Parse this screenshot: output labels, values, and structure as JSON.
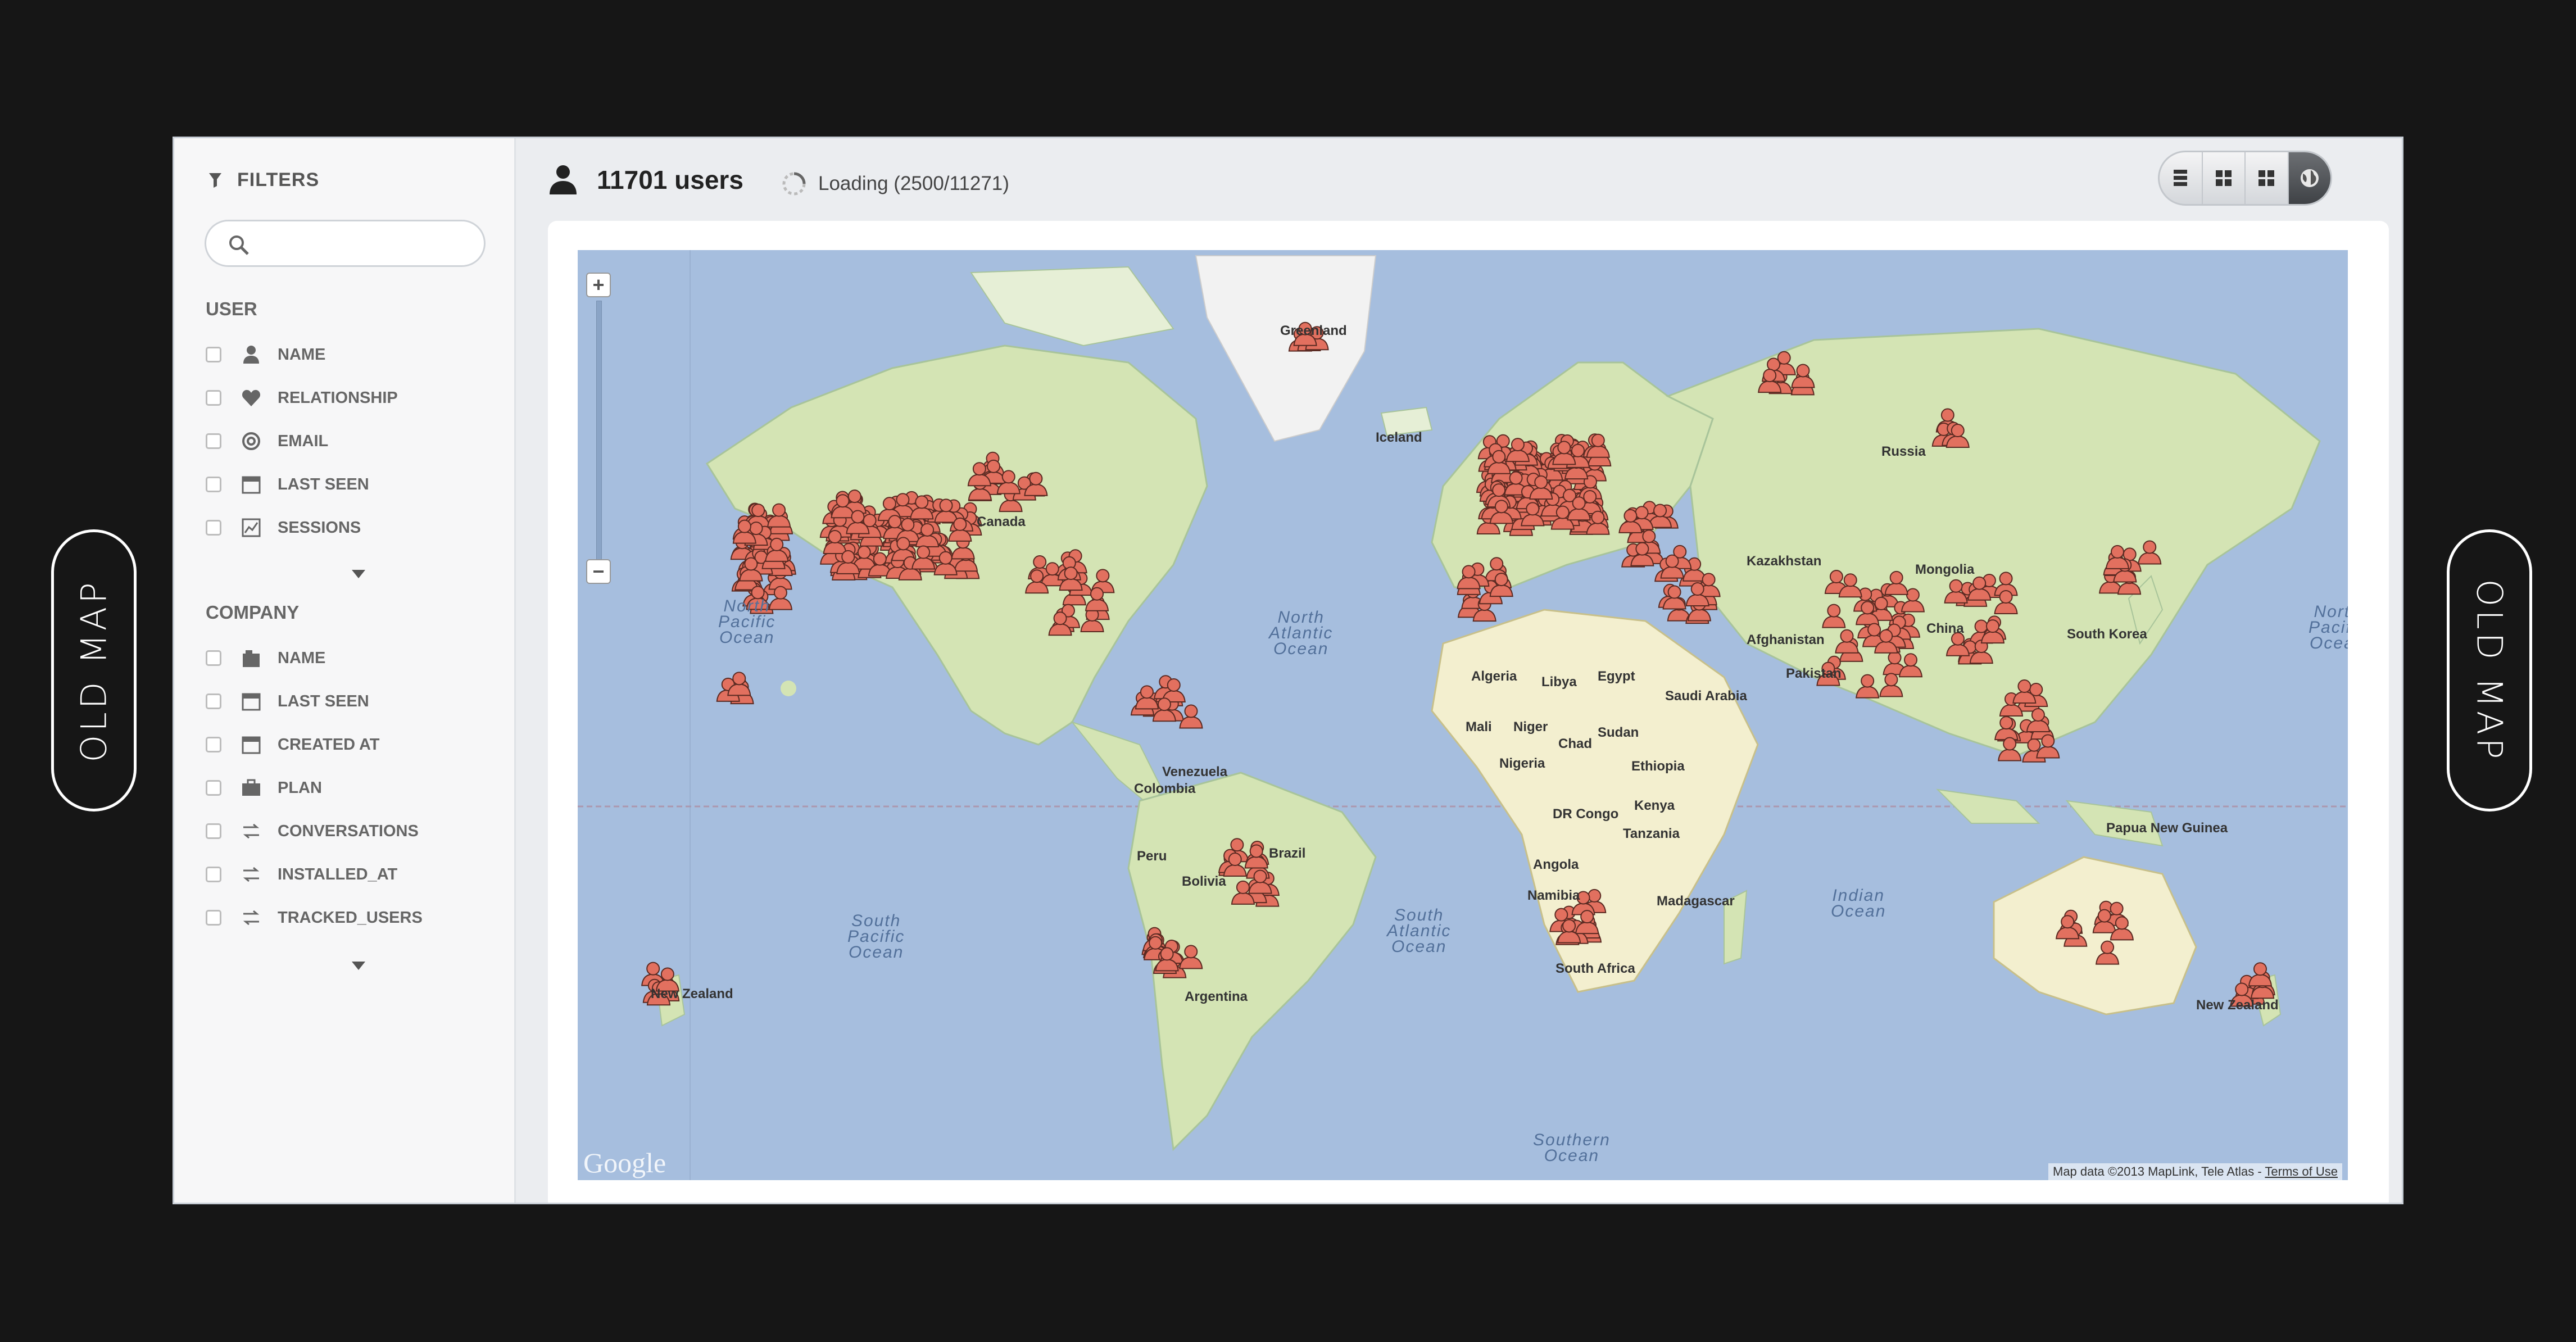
{
  "side_labels": {
    "left": "OLD MAP",
    "right": "OLD MAP"
  },
  "sidebar": {
    "filters_title": "FILTERS",
    "search_placeholder": "",
    "user_group": {
      "title": "USER",
      "items": [
        {
          "label": "NAME",
          "icon": "user-icon"
        },
        {
          "label": "RELATIONSHIP",
          "icon": "heart-icon"
        },
        {
          "label": "EMAIL",
          "icon": "at-icon"
        },
        {
          "label": "LAST SEEN",
          "icon": "calendar-icon"
        },
        {
          "label": "SESSIONS",
          "icon": "chart-icon"
        }
      ]
    },
    "company_group": {
      "title": "COMPANY",
      "items": [
        {
          "label": "NAME",
          "icon": "building-icon"
        },
        {
          "label": "LAST SEEN",
          "icon": "calendar-icon"
        },
        {
          "label": "CREATED AT",
          "icon": "calendar-icon"
        },
        {
          "label": "PLAN",
          "icon": "briefcase-icon"
        },
        {
          "label": "CONVERSATIONS",
          "icon": "sort-icon"
        },
        {
          "label": "INSTALLED_AT",
          "icon": "sort-icon"
        },
        {
          "label": "TRACKED_USERS",
          "icon": "sort-icon"
        }
      ]
    }
  },
  "header": {
    "user_count": "11701 users",
    "loading_text": "Loading (2500/11271)",
    "view_modes": [
      "list-view",
      "grid-view",
      "tile-view",
      "map-view"
    ],
    "active_view": "map-view"
  },
  "map": {
    "labels": {
      "greenland": "Greenland",
      "iceland": "Iceland",
      "russia": "Russia",
      "kazakhstan": "Kazakhstan",
      "mongolia": "Mongolia",
      "china": "China",
      "south_korea": "South Korea",
      "afghanistan": "Afghanistan",
      "pakistan": "Pakistan",
      "saudi_arabia": "Saudi Arabia",
      "algeria": "Algeria",
      "libya": "Libya",
      "egypt": "Egypt",
      "mali": "Mali",
      "niger": "Niger",
      "chad": "Chad",
      "sudan": "Sudan",
      "nigeria": "Nigeria",
      "ethiopia": "Ethiopia",
      "kenya": "Kenya",
      "dr_congo": "DR Congo",
      "tanzania": "Tanzania",
      "angola": "Angola",
      "namibia": "Namibia",
      "madagascar": "Madagascar",
      "south_africa": "South Africa",
      "papua_new_guinea": "Papua New Guinea",
      "venezuela": "Venezuela",
      "colombia": "Colombia",
      "peru": "Peru",
      "bolivia": "Bolivia",
      "brazil": "Brazil",
      "argentina": "Argentina",
      "new_zealand_west": "New Zealand",
      "new_zealand_east": "New Zealand",
      "canada": "Canada"
    },
    "oceans": {
      "north_pacific": "North\nPacific\nOcean",
      "north_atlantic": "North\nAtlantic\nOcean",
      "south_pacific": "South\nPacific\nOcean",
      "south_atlantic": "South\nAtlantic\nOcean",
      "indian": "Indian\nOcean",
      "southern": "Southern\nOcean",
      "north_pacific_east": "North\nPacific\nOcean"
    },
    "google_logo": "Google",
    "attribution": "Map data ©2013 MapLink, Tele Atlas - ",
    "terms": "Terms of Use",
    "marker_color": "#e2705f",
    "land_color": "#d4e4b4",
    "water_color": "#a6bede"
  }
}
